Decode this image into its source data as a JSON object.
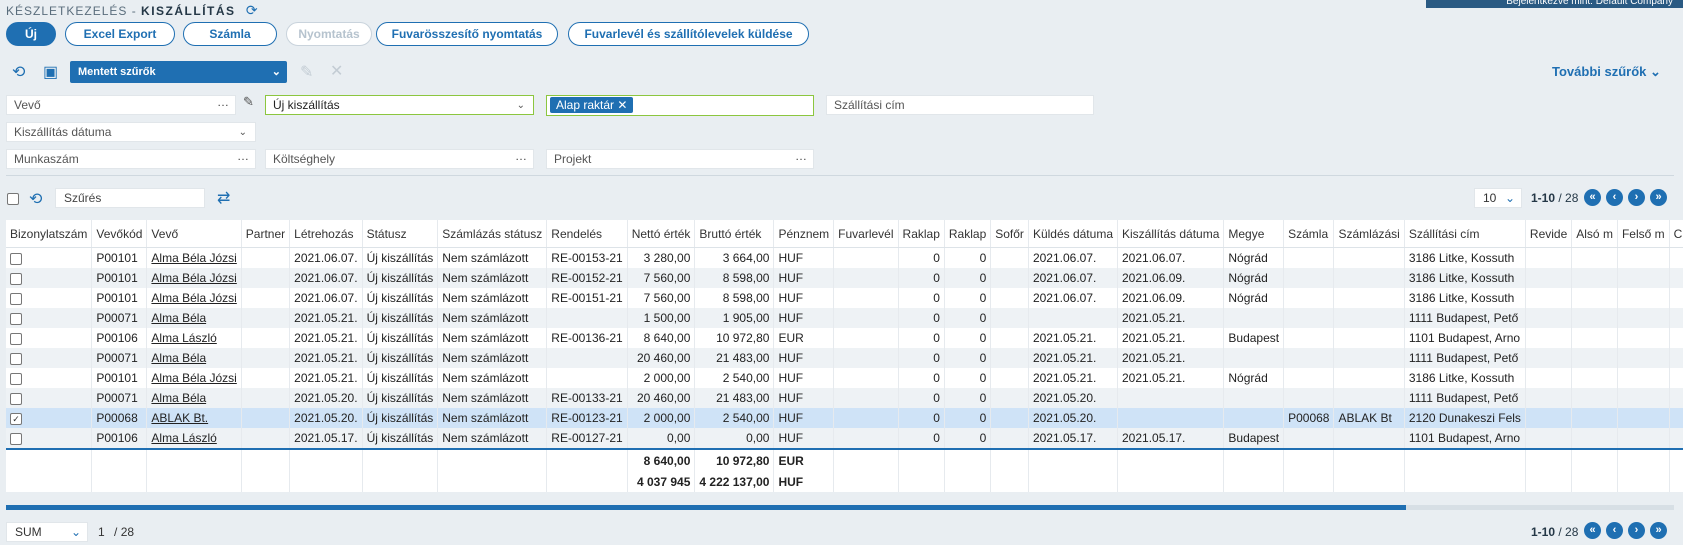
{
  "header": {
    "module": "KÉSZLETKEZELÉS -",
    "page": "KISZÁLLÍTÁS",
    "login": "Bejelentkezve mint: Default Company"
  },
  "toolbar": {
    "new": "Új",
    "excel": "Excel Export",
    "invoice": "Számla",
    "print": "Nyomtatás",
    "waybill_print": "Fuvarösszesítő nyomtatás",
    "send": "Fuvarlevél és szállítólevelek küldése"
  },
  "filters": {
    "saved": "Mentett szűrők",
    "more": "További szűrők",
    "customer": "Vevő",
    "status": "Új kiszállítás",
    "warehouse_tag": "Alap raktár",
    "address": "Szállítási cím",
    "date": "Kiszállítás dátuma",
    "job": "Munkaszám",
    "cost_center": "Költséghely",
    "project": "Projekt"
  },
  "list": {
    "search_placeholder": "Szűrés",
    "page_size": "10",
    "range": "1-10",
    "total": "/ 28"
  },
  "columns": [
    "Bizonylatszám",
    "Vevőkód",
    "Vevő",
    "Partner",
    "Létrehozás",
    "Státusz",
    "Számlázás státusz",
    "Rendelés",
    "Nettó érték",
    "Bruttó érték",
    "Pénznem",
    "Fuvarlevél",
    "Raklap",
    "Raklap",
    "Sofőr",
    "Küldés dátuma",
    "Kiszállítás dátuma",
    "Megye",
    "Számla",
    "Számlázási",
    "Szállítási cím",
    "Revide",
    "Alsó m",
    "Felső m",
    "C"
  ],
  "rows": [
    {
      "checked": false,
      "code": "P00101",
      "customer": "Alma Béla Józsi",
      "created": "2021.06.07.",
      "status": "Új kiszállítás",
      "billing": "Nem számlázott",
      "order": "RE-00153-21",
      "net": "3 280,00",
      "gross": "3 664,00",
      "cur": "HUF",
      "r1": "0",
      "r2": "0",
      "sent": "2021.06.07.",
      "ship": "2021.06.07.",
      "county": "Nógrád",
      "inv": "",
      "invn": "",
      "addr": "3186 Litke, Kossuth"
    },
    {
      "checked": false,
      "code": "P00101",
      "customer": "Alma Béla Józsi",
      "created": "2021.06.07.",
      "status": "Új kiszállítás",
      "billing": "Nem számlázott",
      "order": "RE-00152-21",
      "net": "7 560,00",
      "gross": "8 598,00",
      "cur": "HUF",
      "r1": "0",
      "r2": "0",
      "sent": "2021.06.07.",
      "ship": "2021.06.09.",
      "county": "Nógrád",
      "inv": "",
      "invn": "",
      "addr": "3186 Litke, Kossuth"
    },
    {
      "checked": false,
      "code": "P00101",
      "customer": "Alma Béla Józsi",
      "created": "2021.06.07.",
      "status": "Új kiszállítás",
      "billing": "Nem számlázott",
      "order": "RE-00151-21",
      "net": "7 560,00",
      "gross": "8 598,00",
      "cur": "HUF",
      "r1": "0",
      "r2": "0",
      "sent": "2021.06.07.",
      "ship": "2021.06.09.",
      "county": "Nógrád",
      "inv": "",
      "invn": "",
      "addr": "3186 Litke, Kossuth"
    },
    {
      "checked": false,
      "code": "P00071",
      "customer": "Alma Béla",
      "created": "2021.05.21.",
      "status": "Új kiszállítás",
      "billing": "Nem számlázott",
      "order": "",
      "net": "1 500,00",
      "gross": "1 905,00",
      "cur": "HUF",
      "r1": "0",
      "r2": "0",
      "sent": "",
      "ship": "2021.05.21.",
      "county": "",
      "inv": "",
      "invn": "",
      "addr": "1111 Budapest, Pető"
    },
    {
      "checked": false,
      "code": "P00106",
      "customer": "Alma László",
      "created": "2021.05.21.",
      "status": "Új kiszállítás",
      "billing": "Nem számlázott",
      "order": "RE-00136-21",
      "net": "8 640,00",
      "gross": "10 972,80",
      "cur": "EUR",
      "r1": "0",
      "r2": "0",
      "sent": "2021.05.21.",
      "ship": "2021.05.21.",
      "county": "Budapest",
      "inv": "",
      "invn": "",
      "addr": "1101 Budapest, Arno"
    },
    {
      "checked": false,
      "code": "P00071",
      "customer": "Alma Béla",
      "created": "2021.05.21.",
      "status": "Új kiszállítás",
      "billing": "Nem számlázott",
      "order": "",
      "net": "20 460,00",
      "gross": "21 483,00",
      "cur": "HUF",
      "r1": "0",
      "r2": "0",
      "sent": "2021.05.21.",
      "ship": "2021.05.21.",
      "county": "",
      "inv": "",
      "invn": "",
      "addr": "1111 Budapest, Pető"
    },
    {
      "checked": false,
      "code": "P00101",
      "customer": "Alma Béla Józsi",
      "created": "2021.05.21.",
      "status": "Új kiszállítás",
      "billing": "Nem számlázott",
      "order": "",
      "net": "2 000,00",
      "gross": "2 540,00",
      "cur": "HUF",
      "r1": "0",
      "r2": "0",
      "sent": "2021.05.21.",
      "ship": "2021.05.21.",
      "county": "Nógrád",
      "inv": "",
      "invn": "",
      "addr": "3186 Litke, Kossuth"
    },
    {
      "checked": false,
      "code": "P00071",
      "customer": "Alma Béla",
      "created": "2021.05.20.",
      "status": "Új kiszállítás",
      "billing": "Nem számlázott",
      "order": "RE-00133-21",
      "net": "20 460,00",
      "gross": "21 483,00",
      "cur": "HUF",
      "r1": "0",
      "r2": "0",
      "sent": "2021.05.20.",
      "ship": "",
      "county": "",
      "inv": "",
      "invn": "",
      "addr": "1111 Budapest, Pető"
    },
    {
      "checked": true,
      "code": "P00068",
      "customer": "ABLAK Bt.",
      "created": "2021.05.20.",
      "status": "Új kiszállítás",
      "billing": "Nem számlázott",
      "order": "RE-00123-21",
      "net": "2 000,00",
      "gross": "2 540,00",
      "cur": "HUF",
      "r1": "0",
      "r2": "0",
      "sent": "2021.05.20.",
      "ship": "",
      "county": "",
      "inv": "P00068",
      "invn": "ABLAK Bt",
      "addr": "2120 Dunakeszi Fels"
    },
    {
      "checked": false,
      "code": "P00106",
      "customer": "Alma László",
      "created": "2021.05.17.",
      "status": "Új kiszállítás",
      "billing": "Nem számlázott",
      "order": "RE-00127-21",
      "net": "0,00",
      "gross": "0,00",
      "cur": "HUF",
      "r1": "0",
      "r2": "0",
      "sent": "2021.05.17.",
      "ship": "2021.05.17.",
      "county": "Budapest",
      "inv": "",
      "invn": "",
      "addr": "1101 Budapest, Arno"
    }
  ],
  "sums": [
    {
      "net": "8 640,00",
      "gross": "10 972,80",
      "cur": "EUR"
    },
    {
      "net": "4 037 945",
      "gross": "4 222 137,00",
      "cur": "HUF"
    }
  ],
  "footer": {
    "agg": "SUM",
    "page": "1",
    "pages": "/  28",
    "range": "1-10",
    "total": "/ 28"
  }
}
